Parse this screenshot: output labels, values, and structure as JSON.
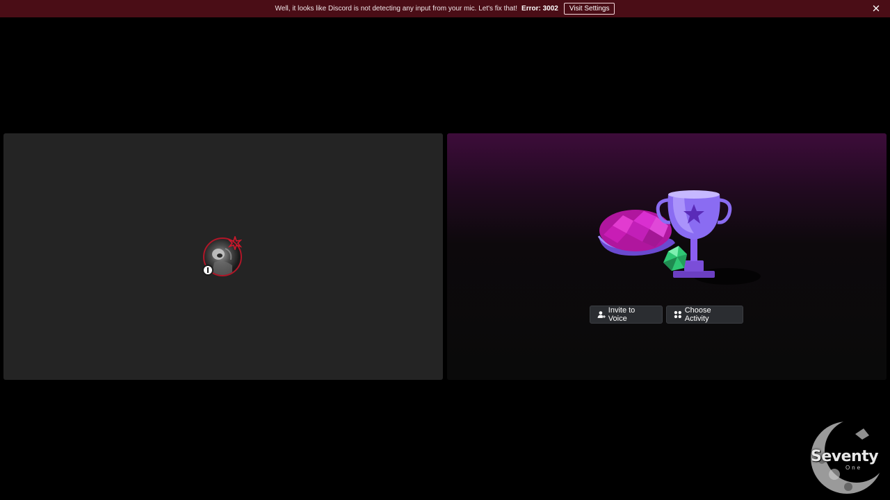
{
  "notice": {
    "message": "Well, it looks like Discord is not detecting any input from your mic. Let's fix that!",
    "error": "Error: 3002",
    "visit_label": "Visit Settings",
    "background": "#4a0d16"
  },
  "activity_tile": {
    "invite_label": "Invite to Voice",
    "activity_label": "Choose Activity",
    "accent": "#3d0c3a"
  },
  "user_tile": {
    "ring_color": "#b11628"
  },
  "watermark": {
    "word": "Seventy",
    "sub": "One"
  },
  "icons": [
    "close-icon",
    "person-add-icon",
    "activity-grid-icon",
    "trophy-illustration",
    "shell-illustration",
    "dice-illustration"
  ]
}
